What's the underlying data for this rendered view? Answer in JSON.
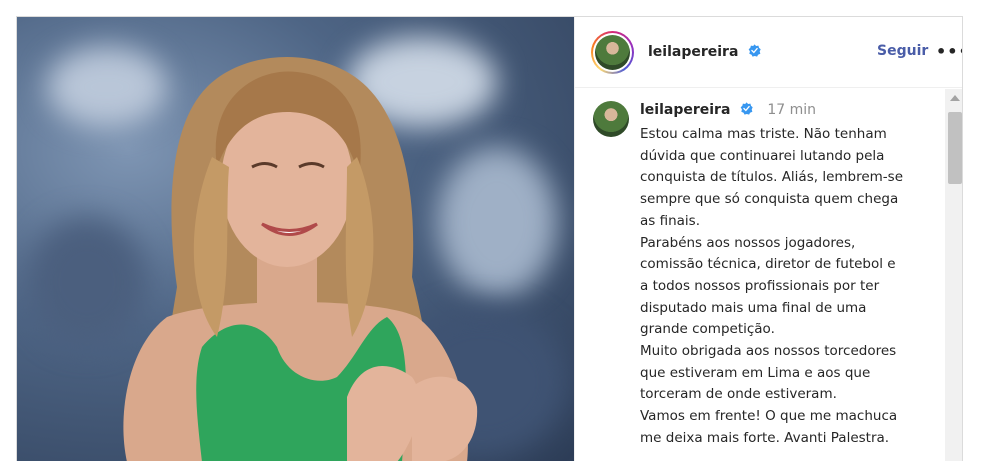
{
  "post": {
    "header": {
      "username": "leilapereira",
      "verified": true,
      "follow_label": "Seguir",
      "more_label": "•••"
    },
    "comment": {
      "username": "leilapereira",
      "verified": true,
      "time": "17 min",
      "caption": "Estou calma mas triste. Não tenham\ndúvida que continuarei lutando pela\nconquista de títulos. Aliás, lembrem-se\nsempre que só conquista quem chega\nas finais.\nParabéns aos nossos jogadores,\ncomissão técnica, diretor de futebol e\na todos nossos profissionais por ter\ndisputado mais uma final de uma\ngrande competição.\nMuito obrigada aos nossos torcedores\nque estiveram em Lima e aos que\ntorceram de onde estiveram.\nVamos em frente! O que me machuca\nme deixa mais forte. Avanti Palestra."
    },
    "colors": {
      "verified_badge": "#3897f0",
      "follow_text": "#4a5da8",
      "dress": "#2fa55c"
    },
    "icons": [
      "verified-badge-icon",
      "more-options-icon",
      "scroll-up-arrow-icon"
    ]
  }
}
